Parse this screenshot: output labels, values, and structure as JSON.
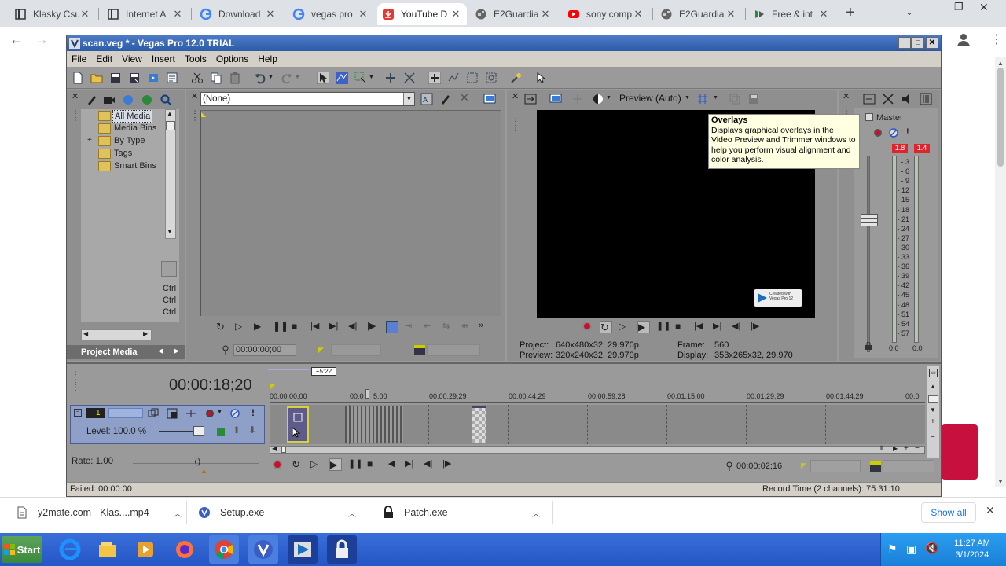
{
  "browser": {
    "tabs": [
      {
        "title": "Klasky Csu",
        "icon": "page-icon"
      },
      {
        "title": "Internet A",
        "icon": "page-icon"
      },
      {
        "title": "Download",
        "icon": "google-icon"
      },
      {
        "title": "vegas pro",
        "icon": "google-icon"
      },
      {
        "title": "YouTube D",
        "icon": "download-icon"
      },
      {
        "title": "E2Guardia",
        "icon": "globe-icon"
      },
      {
        "title": "sony comp",
        "icon": "youtube-icon"
      },
      {
        "title": "E2Guardia",
        "icon": "globe-icon"
      },
      {
        "title": "Free & int",
        "icon": "play-icon"
      }
    ],
    "active_tab": 4,
    "new_tab": "+"
  },
  "vegas": {
    "title": "scan.veg * - Vegas Pro 12.0 TRIAL",
    "menu": [
      "File",
      "Edit",
      "View",
      "Insert",
      "Tools",
      "Options",
      "Help"
    ],
    "project_media": {
      "tree": [
        "All Media",
        "Media Bins",
        "By Type",
        "Tags",
        "Smart Bins"
      ],
      "ctrl_labels": [
        "Ctrl",
        "Ctrl",
        "Ctrl"
      ],
      "panel_label": "Project Media"
    },
    "trimmer": {
      "dropdown_value": "(None)",
      "timecode": "00:00:00;00"
    },
    "preview": {
      "quality": "Preview (Auto)",
      "project_label": "Project:",
      "project_value": "640x480x32, 29.970p",
      "preview_label": "Preview:",
      "preview_value": "320x240x32, 29.970p",
      "frame_label": "Frame:",
      "frame_value": "560",
      "display_label": "Display:",
      "display_value": "353x265x32, 29.970",
      "watermark": "Created with Vegas Pro 12"
    },
    "tooltip": {
      "title": "Overlays",
      "body": "Displays graphical overlays in the Video Preview and Trimmer windows to help you perform visual alignment and color analysis."
    },
    "master": {
      "label": "Master",
      "peak_left": "1.8",
      "peak_right": "1.4",
      "scale": [
        "3",
        "6",
        "9",
        "12",
        "15",
        "18",
        "21",
        "24",
        "27",
        "30",
        "33",
        "36",
        "39",
        "42",
        "45",
        "48",
        "51",
        "54",
        "57"
      ],
      "bottom_left": "0.0",
      "bottom_right": "0.0"
    },
    "timeline": {
      "big_timecode": "00:00:18;20",
      "zoom_label": "+5:22",
      "ruler": [
        "00:00:00;00",
        "00:0",
        "5:00",
        "00:00:29;29",
        "00:00:44;29",
        "00:00:59;28",
        "00:01:15;00",
        "00:01:29;29",
        "00:01:44;29",
        "00:0"
      ],
      "track_number": "1",
      "level": "Level: 100.0 %",
      "rate": "Rate: 1.00",
      "end_timecode": "00:00:02;16"
    },
    "status": {
      "left": "Failed: 00:00:00",
      "right": "Record Time (2 channels): 75:31:10"
    }
  },
  "downloads": {
    "items": [
      "y2mate.com - Klas....mp4",
      "Setup.exe",
      "Patch.exe"
    ],
    "show_all": "Show all"
  },
  "taskbar": {
    "start": "Start",
    "time": "11:27 AM",
    "date": "3/1/2024"
  },
  "colors": {
    "titlebar": "#2b5aa8",
    "taskbar": "#245edb",
    "panel": "#9a9a9a",
    "meter_peak": "#e0242c",
    "accent_red": "#c8103e"
  }
}
